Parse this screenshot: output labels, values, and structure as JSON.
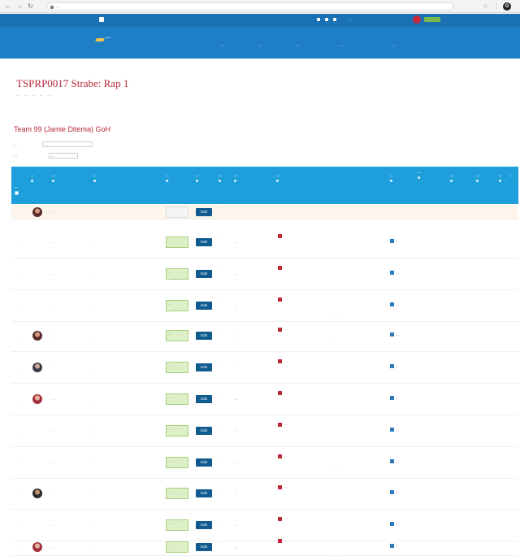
{
  "browser": {
    "url": "...",
    "profile_initial": "G"
  },
  "site": {
    "logo_text": "...",
    "nav_items": [
      "...",
      "...",
      "...",
      "...",
      "..."
    ],
    "user_label": "..."
  },
  "page": {
    "title": "TSPRP0017 Strabe: Rap 1",
    "breadcrumbs": [
      "...",
      "...",
      "...",
      "...",
      "..."
    ]
  },
  "section": {
    "title": "Team 99 (Jamie Ditema) GoH",
    "filter1_label": "...",
    "filter1_value": "...",
    "filter2_label": "...",
    "filter2_value": "..."
  },
  "table": {
    "headers": [
      "...",
      "...",
      "...",
      "...",
      "...",
      "...",
      "...",
      "...",
      "...",
      "...",
      "...",
      "...",
      "...",
      "...",
      "..."
    ],
    "rows": [
      {
        "num": "...",
        "avatar": "photo",
        "name": "...",
        "email": "...",
        "status": "...",
        "button": "Edit",
        "time": "...",
        "activity": "",
        "comment": "",
        "meta": "",
        "badge": ""
      },
      {
        "num": "...",
        "avatar": "blank",
        "name": "...",
        "email": "...",
        "status": "...",
        "button": "Edit",
        "time": "...",
        "activity": "...",
        "comment": "...",
        "meta": "...",
        "badge": "..."
      },
      {
        "num": "...",
        "avatar": "blank",
        "name": "...",
        "email": "...",
        "status": "...",
        "button": "Edit",
        "time": "...",
        "activity": "...",
        "comment": "...",
        "meta": "...",
        "badge": "..."
      },
      {
        "num": "...",
        "avatar": "blank",
        "name": "...",
        "email": "...",
        "status": "...",
        "button": "Edit",
        "time": "...",
        "activity": "...",
        "comment": "...",
        "meta": "...",
        "badge": "..."
      },
      {
        "num": "...",
        "avatar": "photo",
        "name": "...",
        "email": "...",
        "status": "...",
        "button": "Edit",
        "time": "...",
        "activity": "...",
        "comment": "...",
        "meta": "...",
        "badge": "..."
      },
      {
        "num": "...",
        "avatar": "photo2",
        "name": "...",
        "email": "...",
        "status": "...",
        "button": "Edit",
        "time": "...",
        "activity": "...",
        "comment": "...",
        "meta": "...",
        "badge": "..."
      },
      {
        "num": "...",
        "avatar": "photo3",
        "name": "...",
        "email": "...",
        "status": "...",
        "button": "Edit",
        "time": "...",
        "activity": "...",
        "comment": "...",
        "meta": "...",
        "badge": "..."
      },
      {
        "num": "...",
        "avatar": "blank",
        "name": "...",
        "email": "...",
        "status": "...",
        "button": "Edit",
        "time": "...",
        "activity": "...",
        "comment": "...",
        "meta": "...",
        "badge": "..."
      },
      {
        "num": "...",
        "avatar": "blank",
        "name": "...",
        "email": "...",
        "status": "...",
        "button": "Edit",
        "time": "...",
        "activity": "...",
        "comment": "...",
        "meta": "...",
        "badge": "..."
      },
      {
        "num": "...",
        "avatar": "photo4",
        "name": "...",
        "email": "...",
        "status": "...",
        "button": "Edit",
        "time": "...",
        "activity": "...",
        "comment": "...",
        "meta": "...",
        "badge": "..."
      },
      {
        "num": "...",
        "avatar": "blank",
        "name": "...",
        "email": "...",
        "status": "...",
        "button": "Edit",
        "time": "...",
        "activity": "...",
        "comment": "...",
        "meta": "...",
        "badge": "..."
      },
      {
        "num": "...",
        "avatar": "photo3",
        "name": "...",
        "email": "...",
        "status": "...",
        "button": "Edit",
        "time": "...",
        "activity": "...",
        "comment": "...",
        "meta": "...",
        "badge": "..."
      }
    ]
  },
  "colors": {
    "header_blue": "#1e7fc6",
    "table_head_blue": "#1e9fdb",
    "title_red": "#b8283a",
    "button_navy": "#0f5a8f",
    "status_green": "#dcefc7"
  }
}
